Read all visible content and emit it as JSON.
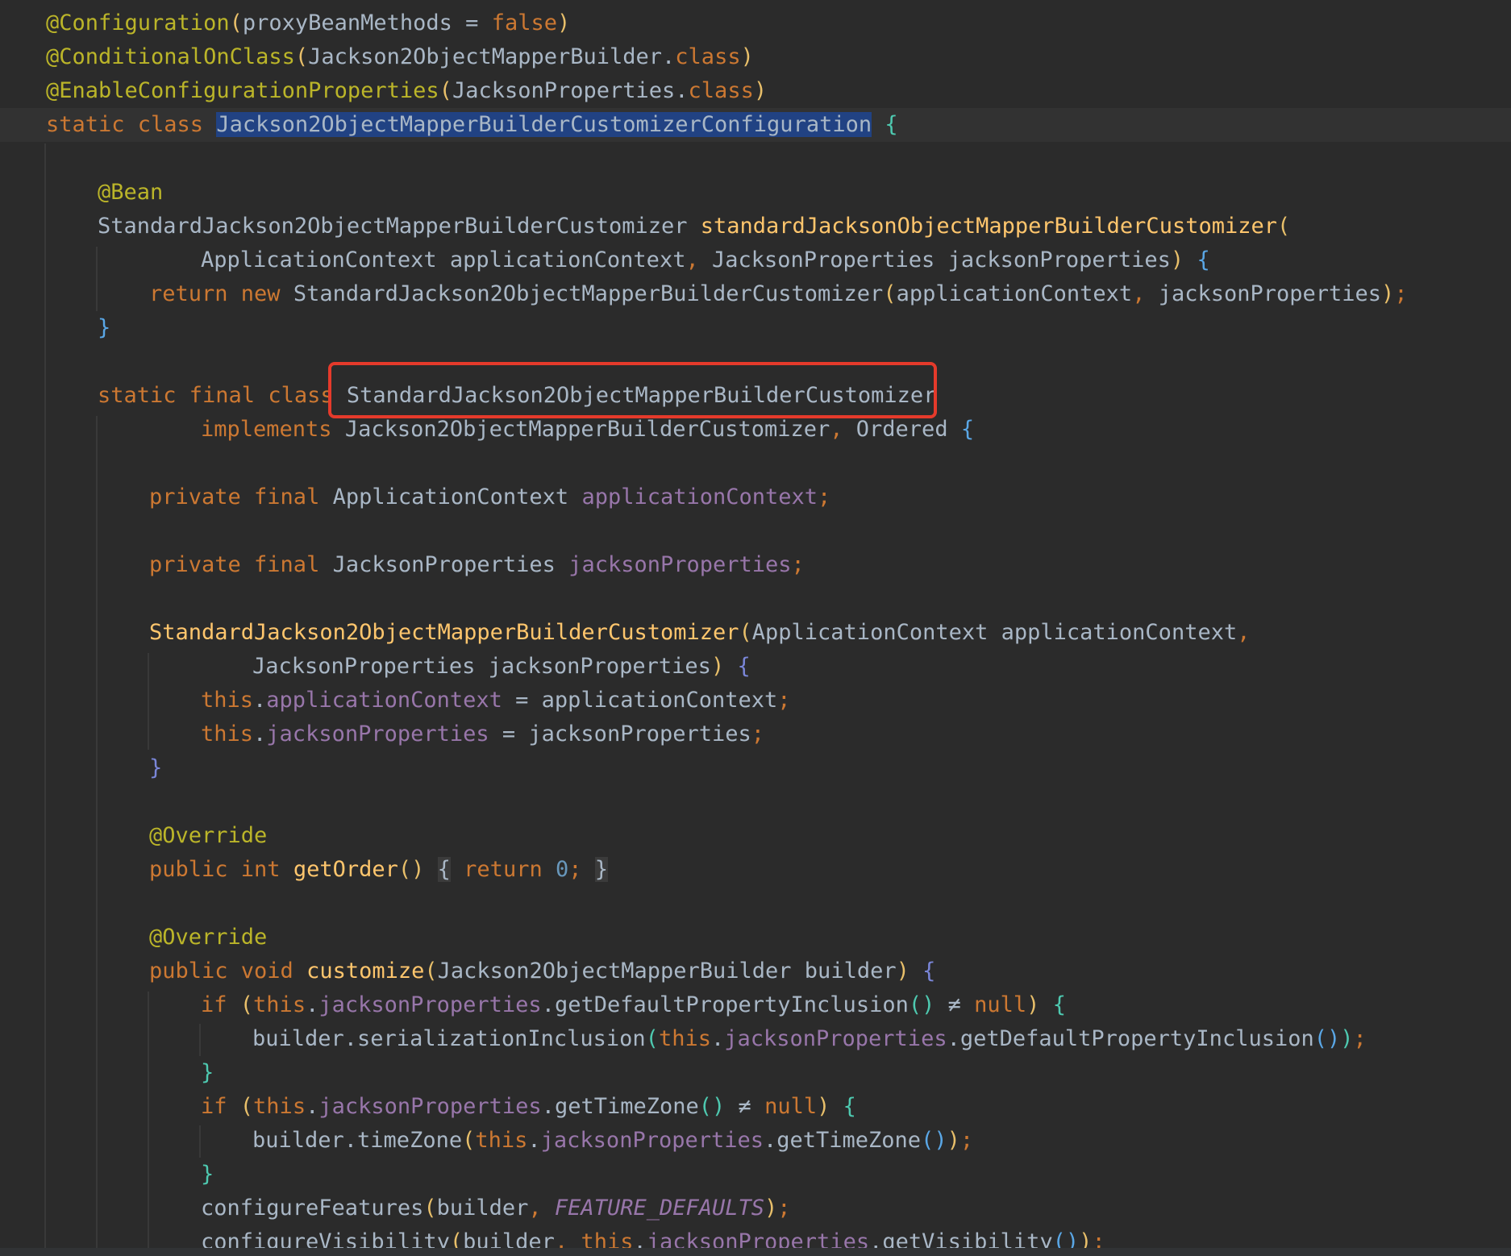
{
  "editor": {
    "language": "java",
    "colors": {
      "background": "#2b2b2b",
      "keyword": "#cc7832",
      "annotation": "#bbb529",
      "field": "#9876aa",
      "method": "#ffc66d",
      "number": "#6897bb",
      "text": "#a9b7c6",
      "selection": "#214283",
      "highlight_box": "#e53a2b"
    },
    "lines": [
      {
        "id": "l1",
        "tokens": [
          "@Configuration",
          "(",
          "proxyBeanMethods = ",
          "false",
          ")"
        ]
      },
      {
        "id": "l2",
        "tokens": [
          "@ConditionalOnClass",
          "(",
          "Jackson2ObjectMapperBuilder",
          ".",
          "class",
          ")"
        ]
      },
      {
        "id": "l3",
        "tokens": [
          "@EnableConfigurationProperties",
          "(",
          "JacksonProperties",
          ".",
          "class",
          ")"
        ]
      },
      {
        "id": "l4",
        "tokens": [
          "static class ",
          "Jackson2ObjectMapperBuilderCustomizerConfiguration",
          " ",
          "{"
        ]
      },
      {
        "id": "l6",
        "tokens": [
          "@Bean"
        ]
      },
      {
        "id": "l7",
        "tokens": [
          "StandardJackson2ObjectMapperBuilderCustomizer ",
          "standardJacksonObjectMapperBuilderCustomizer",
          "("
        ]
      },
      {
        "id": "l8",
        "tokens": [
          "ApplicationContext applicationContext",
          ", ",
          "JacksonProperties jacksonProperties",
          ")",
          " ",
          "{"
        ]
      },
      {
        "id": "l9",
        "tokens": [
          "return new ",
          "StandardJackson2ObjectMapperBuilderCustomizer",
          "(",
          "applicationContext",
          ", ",
          "jacksonProperties",
          ")",
          ";"
        ]
      },
      {
        "id": "l10",
        "tokens": [
          "}"
        ]
      },
      {
        "id": "l12",
        "tokens": [
          "static final class",
          " ",
          "StandardJackson2ObjectMapperBuilderCustomizer"
        ]
      },
      {
        "id": "l13",
        "tokens": [
          "implements ",
          "Jackson2ObjectMapperBuilderCustomizer",
          ", ",
          "Ordered",
          " ",
          "{"
        ]
      },
      {
        "id": "l15",
        "tokens": [
          "private final ",
          "ApplicationContext ",
          "applicationContext",
          ";"
        ]
      },
      {
        "id": "l17",
        "tokens": [
          "private final ",
          "JacksonProperties ",
          "jacksonProperties",
          ";"
        ]
      },
      {
        "id": "l19",
        "tokens": [
          "StandardJackson2ObjectMapperBuilderCustomizer",
          "(",
          "ApplicationContext applicationContext",
          ","
        ]
      },
      {
        "id": "l20",
        "tokens": [
          "JacksonProperties jacksonProperties",
          ")",
          " ",
          "{"
        ]
      },
      {
        "id": "l21",
        "tokens": [
          "this",
          ".",
          "applicationContext",
          " = applicationContext",
          ";"
        ]
      },
      {
        "id": "l22",
        "tokens": [
          "this",
          ".",
          "jacksonProperties",
          " = jacksonProperties",
          ";"
        ]
      },
      {
        "id": "l23",
        "tokens": [
          "}"
        ]
      },
      {
        "id": "l25",
        "tokens": [
          "@Override"
        ]
      },
      {
        "id": "l26",
        "tokens": [
          "public int ",
          "getOrder",
          "()",
          " ",
          "{",
          " ",
          "return ",
          "0",
          ";",
          " ",
          "}"
        ]
      },
      {
        "id": "l28",
        "tokens": [
          "@Override"
        ]
      },
      {
        "id": "l29",
        "tokens": [
          "public void ",
          "customize",
          "(",
          "Jackson2ObjectMapperBuilder builder",
          ")",
          " ",
          "{"
        ]
      },
      {
        "id": "l30",
        "tokens": [
          "if ",
          "(",
          "this",
          ".",
          "jacksonProperties",
          ".getDefaultPropertyInclusion",
          "()",
          " ≠ ",
          "null",
          ")",
          " ",
          "{"
        ]
      },
      {
        "id": "l31",
        "tokens": [
          "builder.serializationInclusion",
          "(",
          "this",
          ".",
          "jacksonProperties",
          ".getDefaultPropertyInclusion",
          "()",
          ")",
          ";"
        ]
      },
      {
        "id": "l32",
        "tokens": [
          "}"
        ]
      },
      {
        "id": "l33",
        "tokens": [
          "if ",
          "(",
          "this",
          ".",
          "jacksonProperties",
          ".getTimeZone",
          "()",
          " ≠ ",
          "null",
          ")",
          " ",
          "{"
        ]
      },
      {
        "id": "l34",
        "tokens": [
          "builder.timeZone",
          "(",
          "this",
          ".",
          "jacksonProperties",
          ".getTimeZone",
          "()",
          ")",
          ";"
        ]
      },
      {
        "id": "l35",
        "tokens": [
          "}"
        ]
      },
      {
        "id": "l36",
        "tokens": [
          "configureFeatures",
          "(",
          "builder",
          ", ",
          "FEATURE_DEFAULTS",
          ")",
          ";"
        ]
      },
      {
        "id": "l37",
        "tokens": [
          "configureVisibility",
          "(",
          "builder",
          ", ",
          "this",
          ".",
          "jacksonProperties",
          ".getVisibility",
          "()",
          ")",
          ";"
        ]
      }
    ]
  }
}
